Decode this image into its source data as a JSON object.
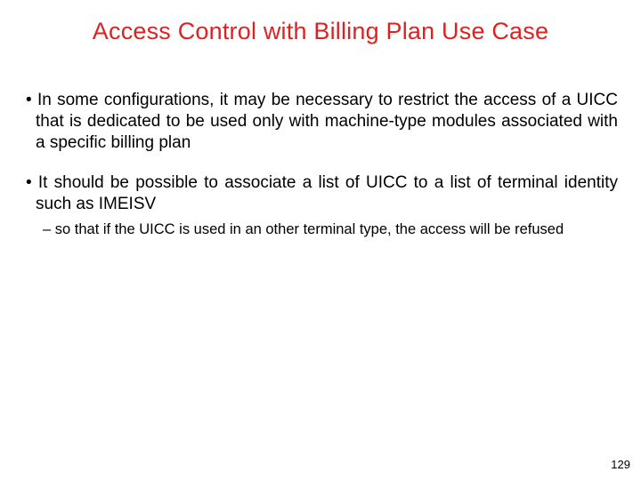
{
  "title": "Access Control with Billing Plan Use Case",
  "bullets": [
    "In some configurations, it may be necessary to restrict the access of a UICC that is dedicated to be used only with machine-type modules associated with a specific billing plan",
    "It should be possible to associate a list of UICC to a list of terminal identity such as IMEISV"
  ],
  "sub_bullet": "so that if the UICC is used in an other terminal type, the access will be refused",
  "page_number": "129"
}
